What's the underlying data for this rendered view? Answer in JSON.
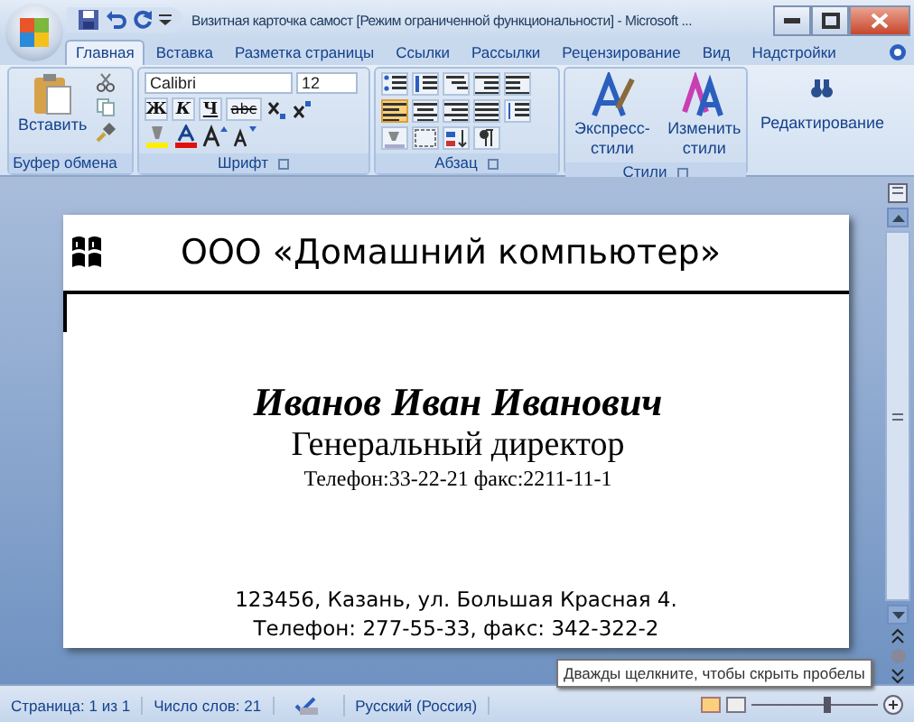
{
  "window": {
    "title": "Визитная карточка самост [Режим ограниченной функциональности] - Microsoft ..."
  },
  "tabs": [
    {
      "label": "Главная",
      "selected": true
    },
    {
      "label": "Вставка",
      "selected": false
    },
    {
      "label": "Разметка страницы",
      "selected": false
    },
    {
      "label": "Ссылки",
      "selected": false
    },
    {
      "label": "Рассылки",
      "selected": false
    },
    {
      "label": "Рецензирование",
      "selected": false
    },
    {
      "label": "Вид",
      "selected": false
    },
    {
      "label": "Надстройки",
      "selected": false
    }
  ],
  "ribbon": {
    "groups": [
      {
        "kind": "clipboard",
        "label": "Буфер обмена",
        "paste": "Вставить"
      },
      {
        "kind": "font",
        "label": "Шрифт",
        "font": "Calibri",
        "size": "12",
        "buttons": [
          "Ж",
          "К",
          "Ч",
          "abc"
        ]
      },
      {
        "kind": "paragraph",
        "label": "Абзац"
      },
      {
        "kind": "styles",
        "label": "Стили",
        "buttons": [
          "Экспресс-стили",
          "Изменить стили"
        ]
      },
      {
        "kind": "editing",
        "button": "Редактирование"
      }
    ]
  },
  "document": {
    "company": "ООО «Домашний компьютер»",
    "name": "Иванов Иван Иванович",
    "position": "Генеральный директор",
    "phone": "Телефон:33-22-21 факс:2211-11-1",
    "address": "123456, Казань, ул. Большая Красная 4.",
    "contacts": "Телефон: 277-55-33, факс: 342-322-2"
  },
  "status_bar": {
    "page": "Страница: 1 из 1",
    "words": "Число слов: 21",
    "language": "Русский (Россия)"
  },
  "tooltip": "Дважды щелкните, чтобы скрыть пробелы"
}
